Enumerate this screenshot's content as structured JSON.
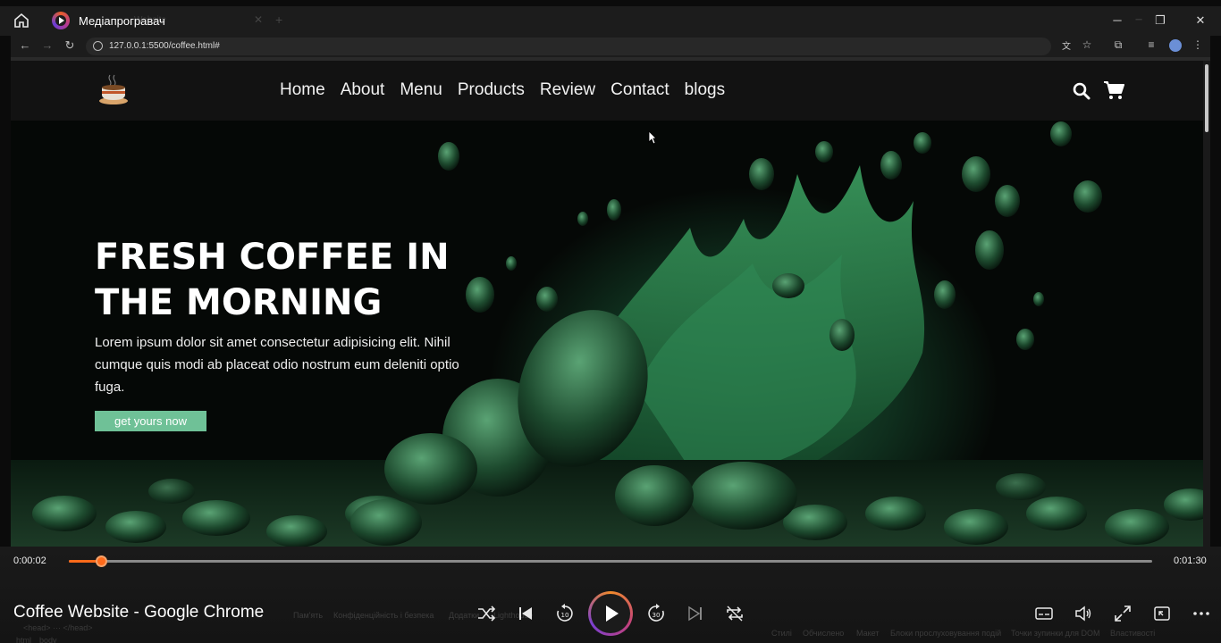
{
  "player": {
    "app_title": "Медіапрогравач",
    "media_title": "Coffee Website - Google Chrome",
    "time_current": "0:00:02",
    "time_total": "0:01:30",
    "progress_fraction": 0.03,
    "ghost_tab": "Website",
    "ghost_devtools_1": "Пам'ять",
    "ghost_devtools_2": "Конфіденційність і безпека",
    "ghost_devtools_3": "Додатки",
    "ghost_devtools_4": "Lighthouse",
    "ghost_bottom": [
      "Стилі",
      "Обчислено",
      "Макет",
      "Блоки прослуховування подій",
      "Точки зупинки для DOM",
      "Властивості"
    ],
    "ghost_code": "<head> ··· </head>",
    "ghost_crumbs": [
      "html",
      "body"
    ]
  },
  "browser": {
    "url": "127.0.0.1:5500/coffee.html#"
  },
  "site": {
    "nav": [
      "Home",
      "About",
      "Menu",
      "Products",
      "Review",
      "Contact",
      "blogs"
    ],
    "hero_title": "FRESH COFFEE IN THE MORNING",
    "hero_text": "Lorem ipsum dolor sit amet consectetur adipisicing elit. Nihil cumque quis modi ab placeat odio nostrum eum deleniti optio fuga.",
    "hero_button": "get yours now"
  },
  "colors": {
    "accent_green": "#6fc197",
    "progress_orange": "#ff6a1a",
    "header_bg": "#121212"
  },
  "icons": [
    "home-icon",
    "search-icon",
    "cart-icon",
    "shuffle-icon",
    "previous-icon",
    "rewind-10-icon",
    "play-icon",
    "forward-30-icon",
    "next-icon",
    "repeat-icon",
    "subtitles-icon",
    "volume-icon",
    "fullscreen-icon",
    "miniplayer-icon",
    "more-icon"
  ]
}
